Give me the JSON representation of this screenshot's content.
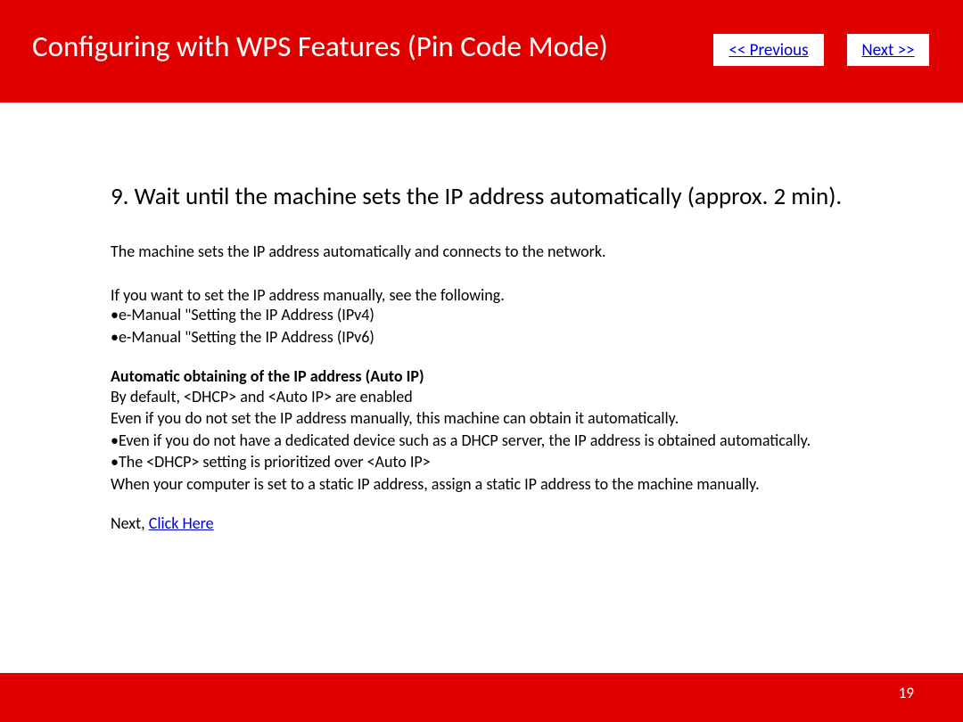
{
  "header": {
    "title": "Configuring with WPS Features (Pin Code Mode)",
    "prev_label": " << Previous",
    "next_label": "Next >>"
  },
  "content": {
    "step_heading": "9. Wait until the machine sets the IP address automatically (approx. 2 min).",
    "intro": "The machine sets the IP address automatically and connects to the network.",
    "manual_note": "If you want to set the IP address manually, see the following.",
    "manual_bullets": [
      "•e-Manual \"Setting the IP Address (IPv4)",
      "•e-Manual \"Setting the IP Address (IPv6)"
    ],
    "auto_ip_title": "Automatic obtaining of the IP address (Auto IP)",
    "auto_ip_lines": [
      "By default, <DHCP> and <Auto IP> are enabled",
      "Even if you do not set the IP address manually, this machine can obtain it automatically.",
      "•Even if you do not have a dedicated device such as a DHCP server, the IP address is obtained automatically.",
      "•The <DHCP> setting is prioritized over <Auto IP>",
      "When your computer is set to a static IP address, assign a static IP address to the machine manually."
    ],
    "next_prefix": "Next, ",
    "next_link": "Click Here"
  },
  "footer": {
    "page_number": "19"
  }
}
